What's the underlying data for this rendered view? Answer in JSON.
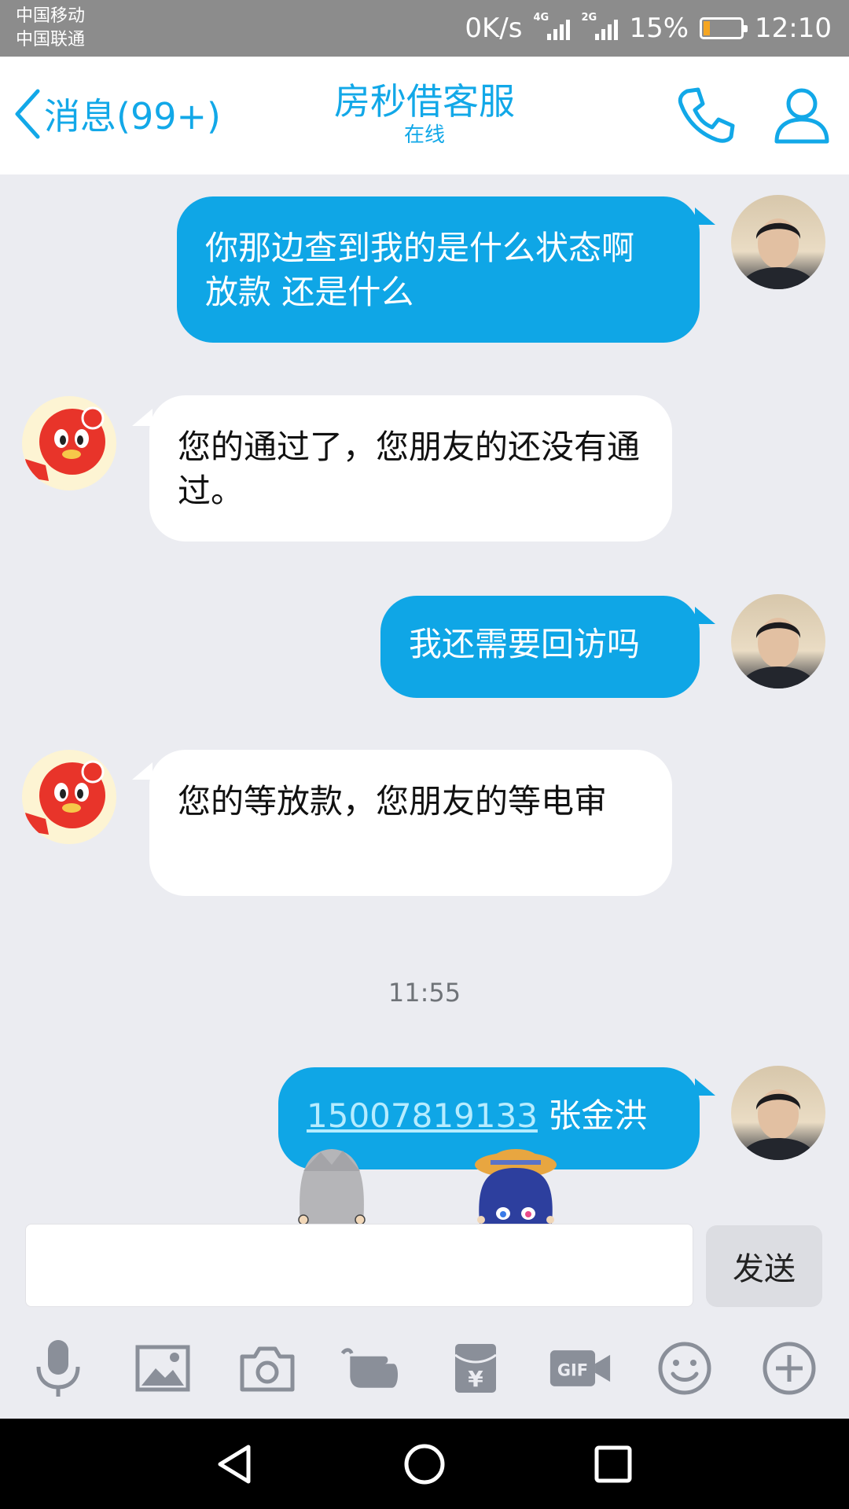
{
  "status_bar": {
    "carrier_1": "中国移动",
    "carrier_2": "中国联通",
    "net_speed": "0K/s",
    "sim1_network": "4G",
    "sim2_network": "2G",
    "battery": "15%",
    "battery_level": 0.15,
    "time": "12:10"
  },
  "header": {
    "back_label": "消息(99+)",
    "title": "房秒借客服",
    "subtitle": "在线",
    "call_icon": "phone-icon",
    "profile_icon": "person-icon"
  },
  "messages": [
    {
      "direction": "out",
      "text": "你那边查到我的是什么状态啊   放款 还是什么"
    },
    {
      "direction": "in",
      "text": "您的通过了，您朋友的还没有通过。"
    },
    {
      "direction": "out",
      "text": "我还需要回访吗"
    },
    {
      "direction": "in",
      "text": "您的等放款，您朋友的等电审"
    },
    {
      "direction": "out",
      "phone": "15007819133",
      "text": " 张金洪"
    }
  ],
  "timestamp": "11:55",
  "composer": {
    "placeholder": "",
    "send_label": "发送"
  },
  "toolbar": [
    "microphone-icon",
    "image-icon",
    "camera-icon",
    "poke-hand-icon",
    "red-packet-icon",
    "gif-icon",
    "emoji-icon",
    "plus-icon"
  ],
  "navbar": [
    "back-triangle-icon",
    "home-circle-icon",
    "recents-square-icon"
  ],
  "colors": {
    "accent": "#12a8e8",
    "outgoing_bubble": "#0fa6e6",
    "incoming_bubble": "#ffffff",
    "chat_background": "#ebecf1",
    "status_bar": "#8c8c8c"
  }
}
